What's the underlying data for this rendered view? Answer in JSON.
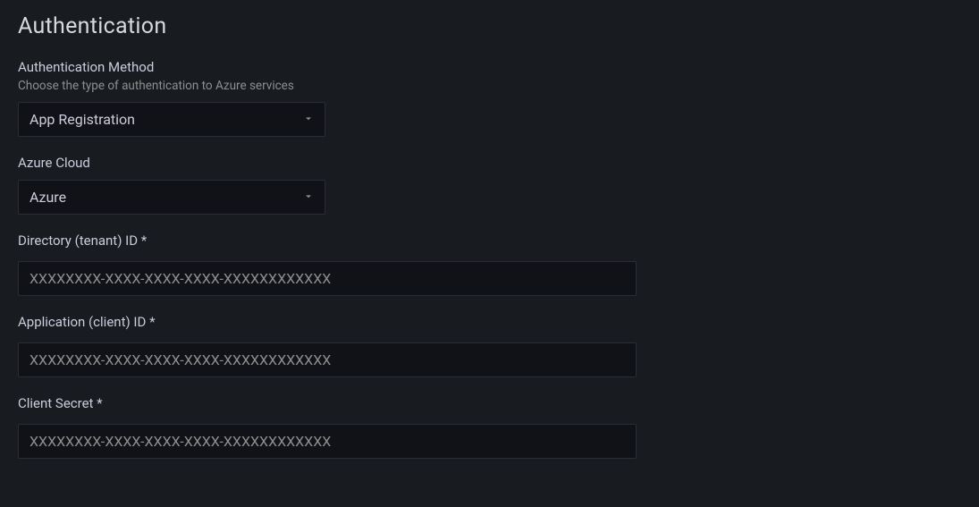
{
  "section": {
    "title": "Authentication"
  },
  "auth_method": {
    "label": "Authentication Method",
    "description": "Choose the type of authentication to Azure services",
    "value": "App Registration"
  },
  "azure_cloud": {
    "label": "Azure Cloud",
    "value": "Azure"
  },
  "tenant_id": {
    "label": "Directory (tenant) ID *",
    "placeholder": "XXXXXXXX-XXXX-XXXX-XXXX-XXXXXXXXXXXX",
    "value": ""
  },
  "client_id": {
    "label": "Application (client) ID *",
    "placeholder": "XXXXXXXX-XXXX-XXXX-XXXX-XXXXXXXXXXXX",
    "value": ""
  },
  "client_secret": {
    "label": "Client Secret *",
    "placeholder": "XXXXXXXX-XXXX-XXXX-XXXX-XXXXXXXXXXXX",
    "value": ""
  }
}
